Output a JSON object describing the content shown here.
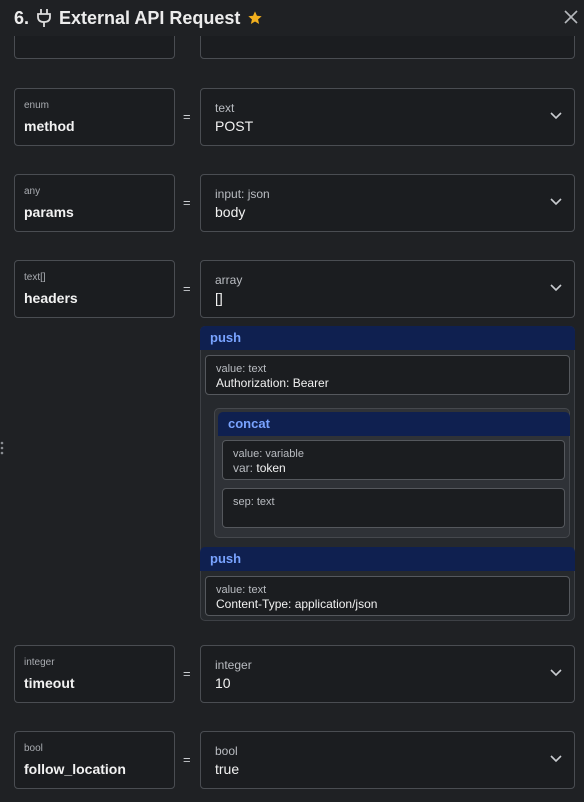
{
  "header": {
    "number": "6.",
    "title": "External API Request",
    "icons": {
      "plug": "plug-icon",
      "star": "star-icon",
      "close": "close-icon"
    },
    "star_color": "#f2b01e"
  },
  "rows": [
    {
      "type": "enum",
      "name": "method",
      "eq": "=",
      "value_type": "text",
      "value": "POST"
    },
    {
      "type": "any",
      "name": "params",
      "eq": "=",
      "value_type": "input: json",
      "value": "body"
    },
    {
      "type": "text[]",
      "name": "headers",
      "eq": "=",
      "value_type": "array",
      "value": "[]"
    },
    {
      "type": "integer",
      "name": "timeout",
      "eq": "=",
      "value_type": "integer",
      "value": "10"
    },
    {
      "type": "bool",
      "name": "follow_location",
      "eq": "=",
      "value_type": "bool",
      "value": "true"
    }
  ],
  "headers_builder": {
    "push1": {
      "label": "push",
      "value_label": "value: text",
      "value": "Authorization: Bearer"
    },
    "concat": {
      "label": "concat",
      "value_label": "value: variable",
      "var_prefix": "var:",
      "var_value": "token",
      "sep_label": "sep: text"
    },
    "push2": {
      "label": "push",
      "value_label": "value: text",
      "value": "Content-Type: application/json"
    }
  },
  "accent_color": "#79a3ff"
}
